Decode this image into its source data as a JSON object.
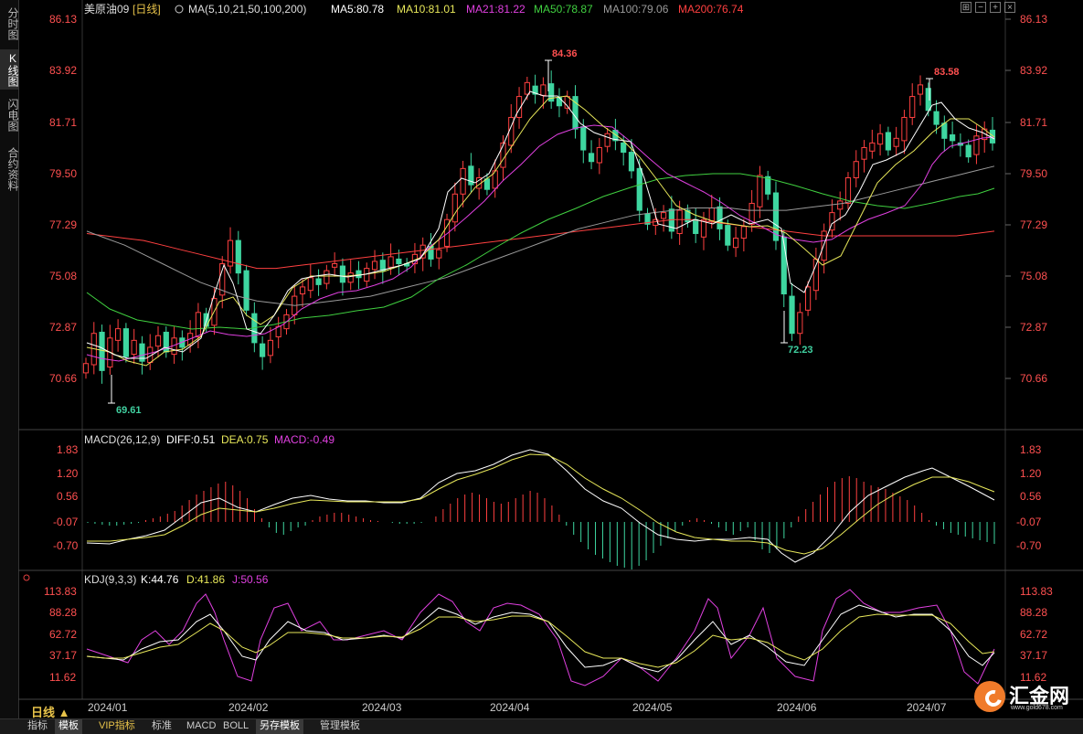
{
  "left_tabs": [
    {
      "label": "分时图",
      "active": false
    },
    {
      "label": "K线图",
      "active": true
    },
    {
      "label": "闪电图",
      "active": false
    },
    {
      "label": "合约资料",
      "active": false
    }
  ],
  "main_panel": {
    "symbol": "美原油09",
    "period_tag": "[日线]",
    "ma_params": "MA(5,10,21,50,100,200)",
    "ma_values": [
      {
        "label": "MA5:80.78",
        "color": "#ffffff"
      },
      {
        "label": "MA10:81.01",
        "color": "#e8e85a"
      },
      {
        "label": "MA21:81.22",
        "color": "#e040e0"
      },
      {
        "label": "MA50:78.87",
        "color": "#40d040"
      },
      {
        "label": "MA100:79.06",
        "color": "#9a9a9a"
      },
      {
        "label": "MA200:76.74",
        "color": "#ff4040"
      }
    ],
    "y_labels": [
      "86.13",
      "83.92",
      "81.71",
      "79.50",
      "77.29",
      "75.08",
      "72.87",
      "70.66"
    ],
    "annotations": [
      {
        "text": "84.36",
        "color": "#ff5050"
      },
      {
        "text": "83.58",
        "color": "#ff5050"
      },
      {
        "text": "72.23",
        "color": "#40d0a0"
      },
      {
        "text": "69.61",
        "color": "#40d0a0"
      }
    ]
  },
  "macd_panel": {
    "title": "MACD(26,12,9)",
    "values": [
      {
        "label": "DIFF:0.51",
        "color": "#ffffff"
      },
      {
        "label": "DEA:0.75",
        "color": "#e8e85a"
      },
      {
        "label": "MACD:-0.49",
        "color": "#e040e0"
      }
    ],
    "y_labels": [
      "1.83",
      "1.20",
      "0.56",
      "-0.07",
      "-0.70"
    ]
  },
  "kdj_panel": {
    "title": "KDJ(9,3,3)",
    "values": [
      {
        "label": "K:44.76",
        "color": "#ffffff"
      },
      {
        "label": "D:41.86",
        "color": "#e8e85a"
      },
      {
        "label": "J:50.56",
        "color": "#e040e0"
      }
    ],
    "y_labels": [
      "113.83",
      "88.28",
      "62.72",
      "37.17",
      "11.62"
    ]
  },
  "x_labels": [
    "2024/01",
    "2024/02",
    "2024/03",
    "2024/04",
    "2024/05",
    "2024/06",
    "2024/07"
  ],
  "period_button": "日线 ▲",
  "bottom_tabs": [
    {
      "label": "指标",
      "active": false,
      "gold": false
    },
    {
      "label": "模板",
      "active": true,
      "gold": false
    },
    {
      "label": "VIP指标",
      "active": false,
      "gold": true
    },
    {
      "label": "标准",
      "active": false,
      "gold": false
    },
    {
      "label": "MACD",
      "active": false,
      "gold": false
    },
    {
      "label": "BOLL",
      "active": false,
      "gold": false
    },
    {
      "label": "另存模板",
      "active": true,
      "gold": false
    },
    {
      "label": "管理模板",
      "active": false,
      "gold": false
    }
  ],
  "logo": {
    "text": "汇金网",
    "url": "www.gold678.com"
  },
  "chart_data": {
    "type": "candlestick",
    "y_range": [
      69.2,
      86.6
    ],
    "ma_series": {
      "ma200": [
        76.9,
        76.8,
        76.7,
        76.6,
        76.4,
        76.2,
        76.0,
        75.8,
        75.6,
        75.4,
        75.4,
        75.5,
        75.6,
        75.7,
        75.8,
        75.9,
        76.0,
        76.1,
        76.2,
        76.3,
        76.4,
        76.5,
        76.6,
        76.7,
        76.8,
        76.9,
        77.0,
        77.1,
        77.2,
        77.3,
        77.4,
        77.5,
        77.5,
        77.4,
        77.3,
        77.2,
        77.1,
        77.0,
        76.9,
        76.8,
        76.8,
        76.8,
        76.8,
        76.8,
        76.8,
        76.8,
        76.8,
        76.9,
        77.0
      ],
      "ma100": [
        77.0,
        76.7,
        76.4,
        76.0,
        75.6,
        75.2,
        74.8,
        74.5,
        74.2,
        74.0,
        73.9,
        73.8,
        73.9,
        74.0,
        74.1,
        74.2,
        74.4,
        74.6,
        74.8,
        75.0,
        75.3,
        75.6,
        75.9,
        76.2,
        76.5,
        76.8,
        77.1,
        77.3,
        77.5,
        77.7,
        77.8,
        77.9,
        78.0,
        78.0,
        78.0,
        77.9,
        77.9,
        77.9,
        78.0,
        78.1,
        78.2,
        78.4,
        78.6,
        78.8,
        79.0,
        79.2,
        79.4,
        79.6,
        79.8
      ]
    },
    "highlights": {
      "high1": 84.36,
      "high2": 83.58,
      "low1": 72.23,
      "low2": 69.61
    }
  }
}
